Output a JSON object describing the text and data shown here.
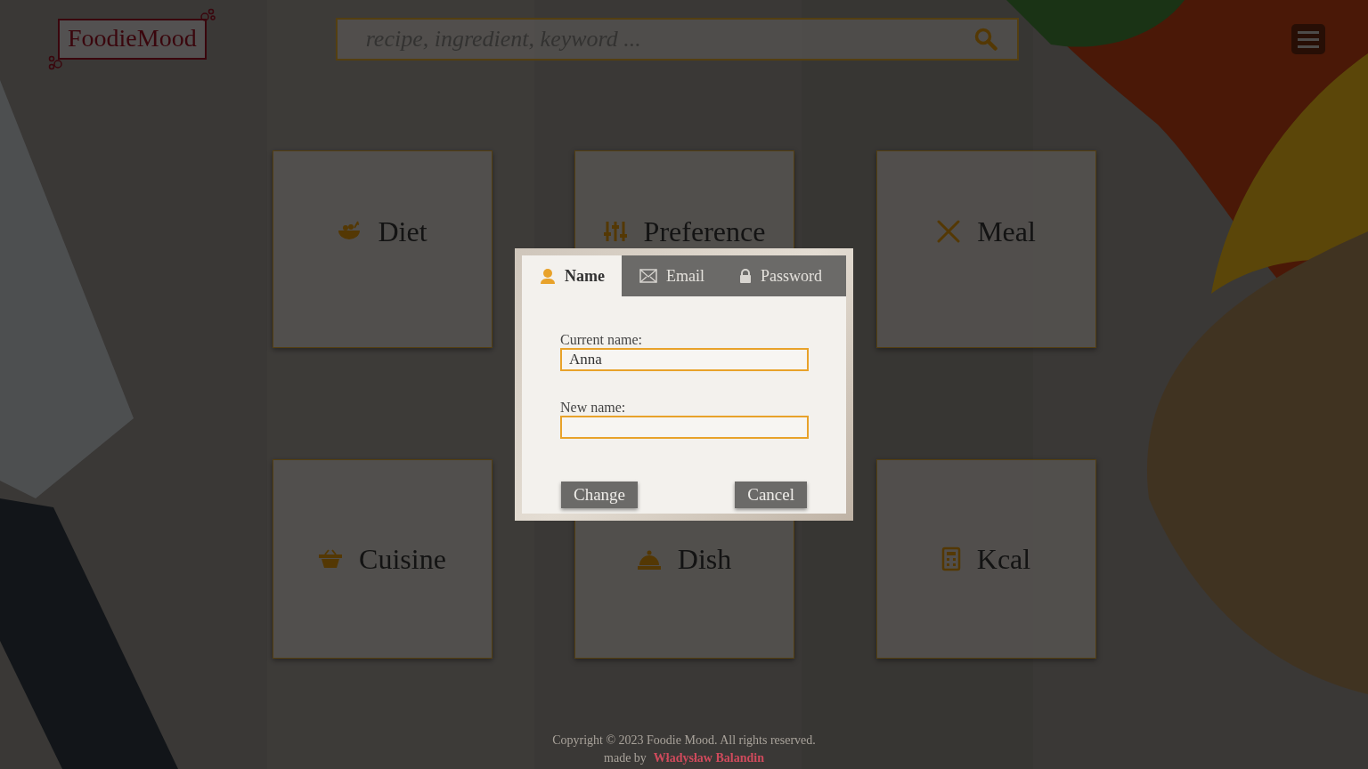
{
  "logo": {
    "text": "FoodieMood"
  },
  "search": {
    "placeholder": "recipe, ingredient, keyword ..."
  },
  "categories": [
    {
      "label": "Diet"
    },
    {
      "label": "Preference"
    },
    {
      "label": "Meal"
    },
    {
      "label": "Cuisine"
    },
    {
      "label": "Dish"
    },
    {
      "label": "Kcal"
    }
  ],
  "dialog": {
    "tabs": [
      {
        "label": "Name",
        "selected": true
      },
      {
        "label": "Email",
        "selected": false
      },
      {
        "label": "Password",
        "selected": false
      }
    ],
    "fields": [
      {
        "label": "Current name:",
        "value": "Anna"
      },
      {
        "label": "New name:"
      }
    ],
    "buttons": [
      "Change",
      "Cancel"
    ]
  },
  "footer": {
    "copyright": "Copyright © 2023 Foodie Mood. All rights reserved.",
    "made_by": "made by",
    "author": "Władysław Balandin"
  }
}
